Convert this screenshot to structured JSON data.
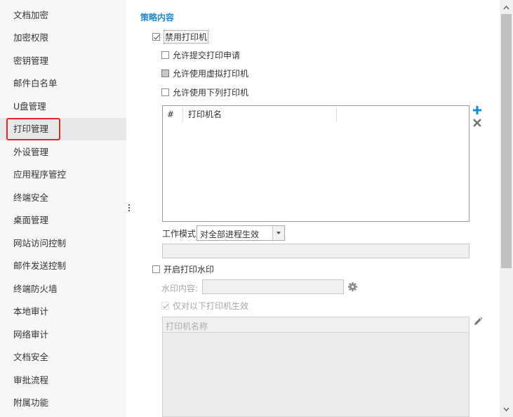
{
  "sidebar": {
    "items": [
      {
        "label": "文档加密"
      },
      {
        "label": "加密权限"
      },
      {
        "label": "密钥管理"
      },
      {
        "label": "邮件白名单"
      },
      {
        "label": "U盘管理"
      },
      {
        "label": "打印管理",
        "active": true
      },
      {
        "label": "外设管理"
      },
      {
        "label": "应用程序管控"
      },
      {
        "label": "终端安全"
      },
      {
        "label": "桌面管理"
      },
      {
        "label": "网站访问控制"
      },
      {
        "label": "邮件发送控制"
      },
      {
        "label": "终端防火墙"
      },
      {
        "label": "本地审计"
      },
      {
        "label": "网络审计"
      },
      {
        "label": "文档安全"
      },
      {
        "label": "审批流程"
      },
      {
        "label": "附属功能"
      }
    ]
  },
  "main": {
    "section_title": "策略内容",
    "disable_printer": {
      "label": "禁用打印机",
      "checked": true
    },
    "allow_submit_request": {
      "label": "允许提交打印申请",
      "checked": false
    },
    "allow_virtual_printer": {
      "label": "允许使用虚拟打印机",
      "checked": false
    },
    "allow_listed_printers": {
      "label": "允许使用下列打印机",
      "checked": false
    },
    "printer_table": {
      "columns": [
        "#",
        "打印机名"
      ],
      "rows": []
    },
    "work_mode": {
      "label": "工作模式",
      "value": "对全部进程生效"
    },
    "watermark": {
      "enable_label": "开启打印水印",
      "content_label": "水印内容:",
      "content_value": "",
      "only_printers_label": "仅对以下打印机生效",
      "printer_name_placeholder": "打印机名称"
    }
  },
  "colors": {
    "accent": "#1b8ad3",
    "highlight_border": "#e5242b",
    "sidebar_bg": "#f7f7f7"
  },
  "icons": [
    "plus-icon",
    "close-icon",
    "gear-icon",
    "pencil-icon",
    "chevron-down-icon",
    "arrow-up-icon",
    "arrow-down-icon"
  ]
}
